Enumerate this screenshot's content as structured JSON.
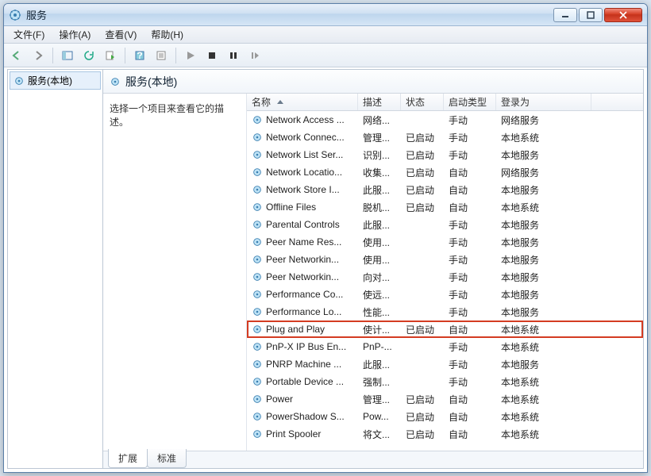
{
  "window": {
    "title": "服务"
  },
  "menu": {
    "file": "文件(F)",
    "action": "操作(A)",
    "view": "查看(V)",
    "help": "帮助(H)"
  },
  "tree": {
    "root": "服务(本地)"
  },
  "header": {
    "title": "服务(本地)"
  },
  "desc": {
    "prompt": "选择一个项目来查看它的描述。"
  },
  "columns": {
    "name": "名称",
    "desc": "描述",
    "status": "状态",
    "startup": "启动类型",
    "logon": "登录为"
  },
  "tabs": {
    "extended": "扩展",
    "standard": "标准"
  },
  "services": [
    {
      "name": "Network Access ...",
      "desc": "网络...",
      "status": "",
      "startup": "手动",
      "logon": "网络服务"
    },
    {
      "name": "Network Connec...",
      "desc": "管理...",
      "status": "已启动",
      "startup": "手动",
      "logon": "本地系统"
    },
    {
      "name": "Network List Ser...",
      "desc": "识别...",
      "status": "已启动",
      "startup": "手动",
      "logon": "本地服务"
    },
    {
      "name": "Network Locatio...",
      "desc": "收集...",
      "status": "已启动",
      "startup": "自动",
      "logon": "网络服务"
    },
    {
      "name": "Network Store I...",
      "desc": "此服...",
      "status": "已启动",
      "startup": "自动",
      "logon": "本地服务"
    },
    {
      "name": "Offline Files",
      "desc": "脱机...",
      "status": "已启动",
      "startup": "自动",
      "logon": "本地系统"
    },
    {
      "name": "Parental Controls",
      "desc": "此服...",
      "status": "",
      "startup": "手动",
      "logon": "本地服务"
    },
    {
      "name": "Peer Name Res...",
      "desc": "使用...",
      "status": "",
      "startup": "手动",
      "logon": "本地服务"
    },
    {
      "name": "Peer Networkin...",
      "desc": "使用...",
      "status": "",
      "startup": "手动",
      "logon": "本地服务"
    },
    {
      "name": "Peer Networkin...",
      "desc": "向对...",
      "status": "",
      "startup": "手动",
      "logon": "本地服务"
    },
    {
      "name": "Performance Co...",
      "desc": "使远...",
      "status": "",
      "startup": "手动",
      "logon": "本地服务"
    },
    {
      "name": "Performance Lo...",
      "desc": "性能...",
      "status": "",
      "startup": "手动",
      "logon": "本地服务"
    },
    {
      "name": "Plug and Play",
      "desc": "使计...",
      "status": "已启动",
      "startup": "自动",
      "logon": "本地系统",
      "highlight": true
    },
    {
      "name": "PnP-X IP Bus En...",
      "desc": "PnP-...",
      "status": "",
      "startup": "手动",
      "logon": "本地系统"
    },
    {
      "name": "PNRP Machine ...",
      "desc": "此服...",
      "status": "",
      "startup": "手动",
      "logon": "本地服务"
    },
    {
      "name": "Portable Device ...",
      "desc": "强制...",
      "status": "",
      "startup": "手动",
      "logon": "本地系统"
    },
    {
      "name": "Power",
      "desc": "管理...",
      "status": "已启动",
      "startup": "自动",
      "logon": "本地系统"
    },
    {
      "name": "PowerShadow S...",
      "desc": "Pow...",
      "status": "已启动",
      "startup": "自动",
      "logon": "本地系统"
    },
    {
      "name": "Print Spooler",
      "desc": "将文...",
      "status": "已启动",
      "startup": "自动",
      "logon": "本地系统"
    }
  ]
}
